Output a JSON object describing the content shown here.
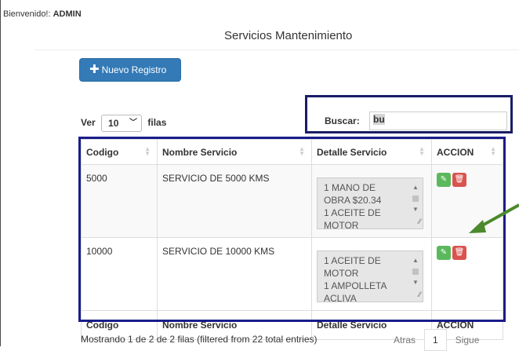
{
  "welcome": {
    "prefix": "Bienvenido!: ",
    "user": "ADMIN"
  },
  "page_title": "Servicios Mantenimiento",
  "new_button": {
    "icon": "plus-icon",
    "label": "Nuevo Registro"
  },
  "length": {
    "prefix": "Ver",
    "value": "10",
    "suffix": "filas"
  },
  "search": {
    "label": "Buscar:",
    "value": "bu"
  },
  "table": {
    "columns": [
      "Codigo",
      "Nombre Servicio",
      "Detalle Servicio",
      "ACCION"
    ],
    "rows": [
      {
        "codigo": "5000",
        "nombre": "SERVICIO DE 5000 KMS",
        "detalle": [
          "1 MANO DE",
          "OBRA $20.34",
          "1 ACEITE DE",
          "MOTOR"
        ]
      },
      {
        "codigo": "10000",
        "nombre": "SERVICIO DE 10000 KMS",
        "detalle": [
          "1 ACEITE DE",
          "MOTOR",
          "1 AMPOLLETA",
          "ACLIVA"
        ]
      }
    ],
    "footer": [
      "Codigo",
      "Nombre Servicio",
      "Detalle Servicio",
      "ACCION"
    ]
  },
  "action_icons": {
    "edit": "edit-icon",
    "delete": "trash-icon"
  },
  "info": "Mostrando 1 de 2 de 2 filas (filtered from 22 total entries)",
  "pagination": {
    "prev": "Atras",
    "current": "1",
    "next": "Sigue"
  },
  "colors": {
    "primary": "#337ab7",
    "edit": "#5cb85c",
    "delete": "#d9534f",
    "highlight_box": "#1a1d66",
    "table_outline": "#1a1d8a",
    "arrow": "#4a8a2c"
  }
}
